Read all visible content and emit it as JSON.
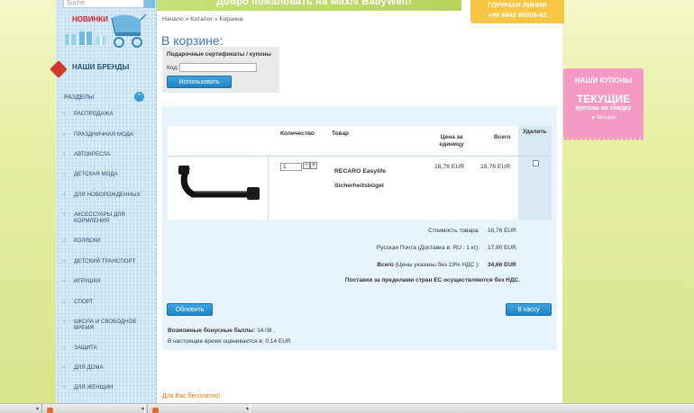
{
  "header": {
    "search_placeholder": "Suche",
    "welcome": "Добро пожаловать на Maxis BabyWelt!",
    "hotline_title": "ГОРЯЧАЯ ЛИНИЯ",
    "hotline_phone": "+49 6842 96008-62"
  },
  "sidebar": {
    "new_label": "НОВИНКИ",
    "brands_label": "НАШИ БРЕНДЫ",
    "sections_label": "РАЗДЕЛЫ",
    "categories": [
      "РАСПРОДАЖА",
      "ПРАЗДНИЧНАЯ МОДА",
      "АВТОКРЕСЛА",
      "ДЕТСКАЯ МОДА",
      "ДЛЯ НОВОРОЖДЕННЫХ",
      "АКСЕССУАРЫ ДЛЯ КОРМЛЕНИЯ",
      "КОЛЯСКИ",
      "ДЕТСКИЙ ТРАНСПОРТ",
      "ИГРУШКИ",
      "СПОРТ",
      "ШКОЛА И СВОБОДНОЕ ВРЕМЯ",
      "ЗАЩИТА",
      "ДЛЯ ДОМА",
      "ДЛЯ ЖЕНЩИН"
    ]
  },
  "breadcrumb": {
    "home": "Начало",
    "sep": "»",
    "catalog": "Каталог",
    "cart": "Корзина"
  },
  "page_title": "В корзине:",
  "coupon": {
    "title": "Подарочные сертификаты / купоны",
    "code_label": "Код:",
    "code_value": "",
    "apply_button": "Использовать"
  },
  "cart": {
    "headers": {
      "quantity": "Количество",
      "product": "Товар",
      "unit_price": "Цена за единицу",
      "total": "Всего",
      "delete": "Удалить"
    },
    "items": [
      {
        "quantity": "1",
        "name": "RECARO Easylife",
        "subname": "Sicherheitsbügel",
        "unit_price": "16,76 EUR",
        "total": "16,76 EUR",
        "delete_checked": false
      }
    ],
    "subtotal_label": "Стоимость товара:",
    "subtotal_value": "16,76 EUR",
    "shipping_label": "Русская Почта (Доставка в: RU : 1 кг):",
    "shipping_value": "17,90 EUR",
    "total_label": "Всего",
    "total_note": "(Цены указаны без 19% НДС ):",
    "total_value": "34,66 EUR",
    "tax_note": "Поставки за пределами стран ЕС осуществляются без НДС.",
    "update_button": "Обновить",
    "checkout_button": "В кассу",
    "bonus_label": "Возможные бонусные баллы:",
    "bonus_value": "14.08 .",
    "bonus_worth": "В настоящее время оценивается в: 0,14 EUR"
  },
  "free_for_you": "Для Вас бесплатно!",
  "promo": {
    "title": "НАШИ КУПОНЫ",
    "big": "ТЕКУЩИЕ",
    "sub": "купоны на скидку",
    "more": "больше"
  },
  "colors": {
    "accent_blue": "#2a8fd0",
    "promo_pink": "#f59ac4",
    "hotline_yellow": "#f7c744",
    "free_orange": "#e77817"
  }
}
